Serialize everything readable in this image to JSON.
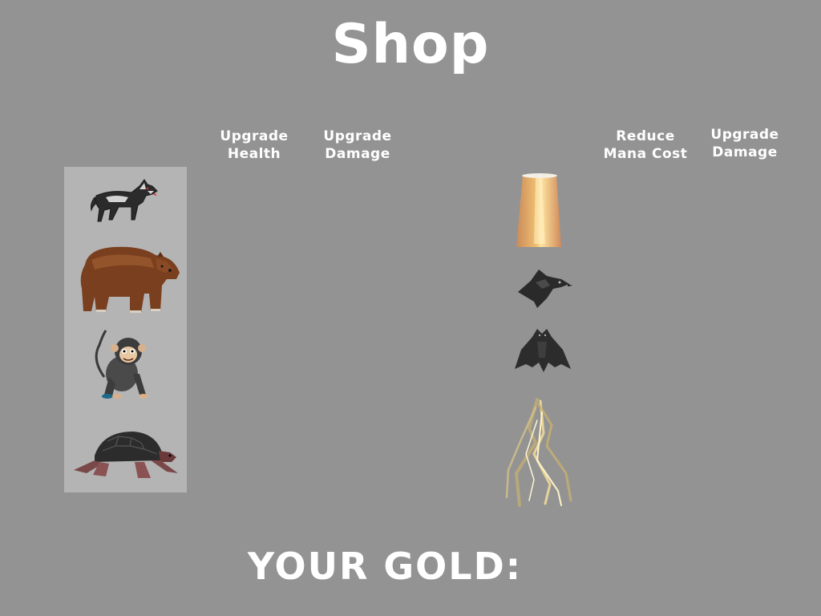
{
  "shop": {
    "title": "Shop",
    "gold_label": "YOUR GOLD:"
  },
  "creature_columns": [
    {
      "line1": "Upgrade",
      "line2": "Health"
    },
    {
      "line1": "Upgrade",
      "line2": "Damage"
    }
  ],
  "spell_columns": [
    {
      "line1": "Reduce",
      "line2": "Mana Cost"
    },
    {
      "line1": "Upgrade",
      "line2": "Damage"
    }
  ],
  "creatures": [
    {
      "name": "wolf",
      "icon": "wolf-icon"
    },
    {
      "name": "bear",
      "icon": "bear-icon"
    },
    {
      "name": "monkey",
      "icon": "monkey-icon"
    },
    {
      "name": "turtle",
      "icon": "turtle-icon"
    }
  ],
  "spells": [
    {
      "name": "light-beam",
      "icon": "light-beam-icon"
    },
    {
      "name": "crow",
      "icon": "crow-icon"
    },
    {
      "name": "bat",
      "icon": "bat-icon"
    },
    {
      "name": "lightning",
      "icon": "lightning-icon"
    }
  ],
  "colors": {
    "background": "#939393",
    "panel": "#b4b4b4",
    "text": "#ffffff"
  }
}
